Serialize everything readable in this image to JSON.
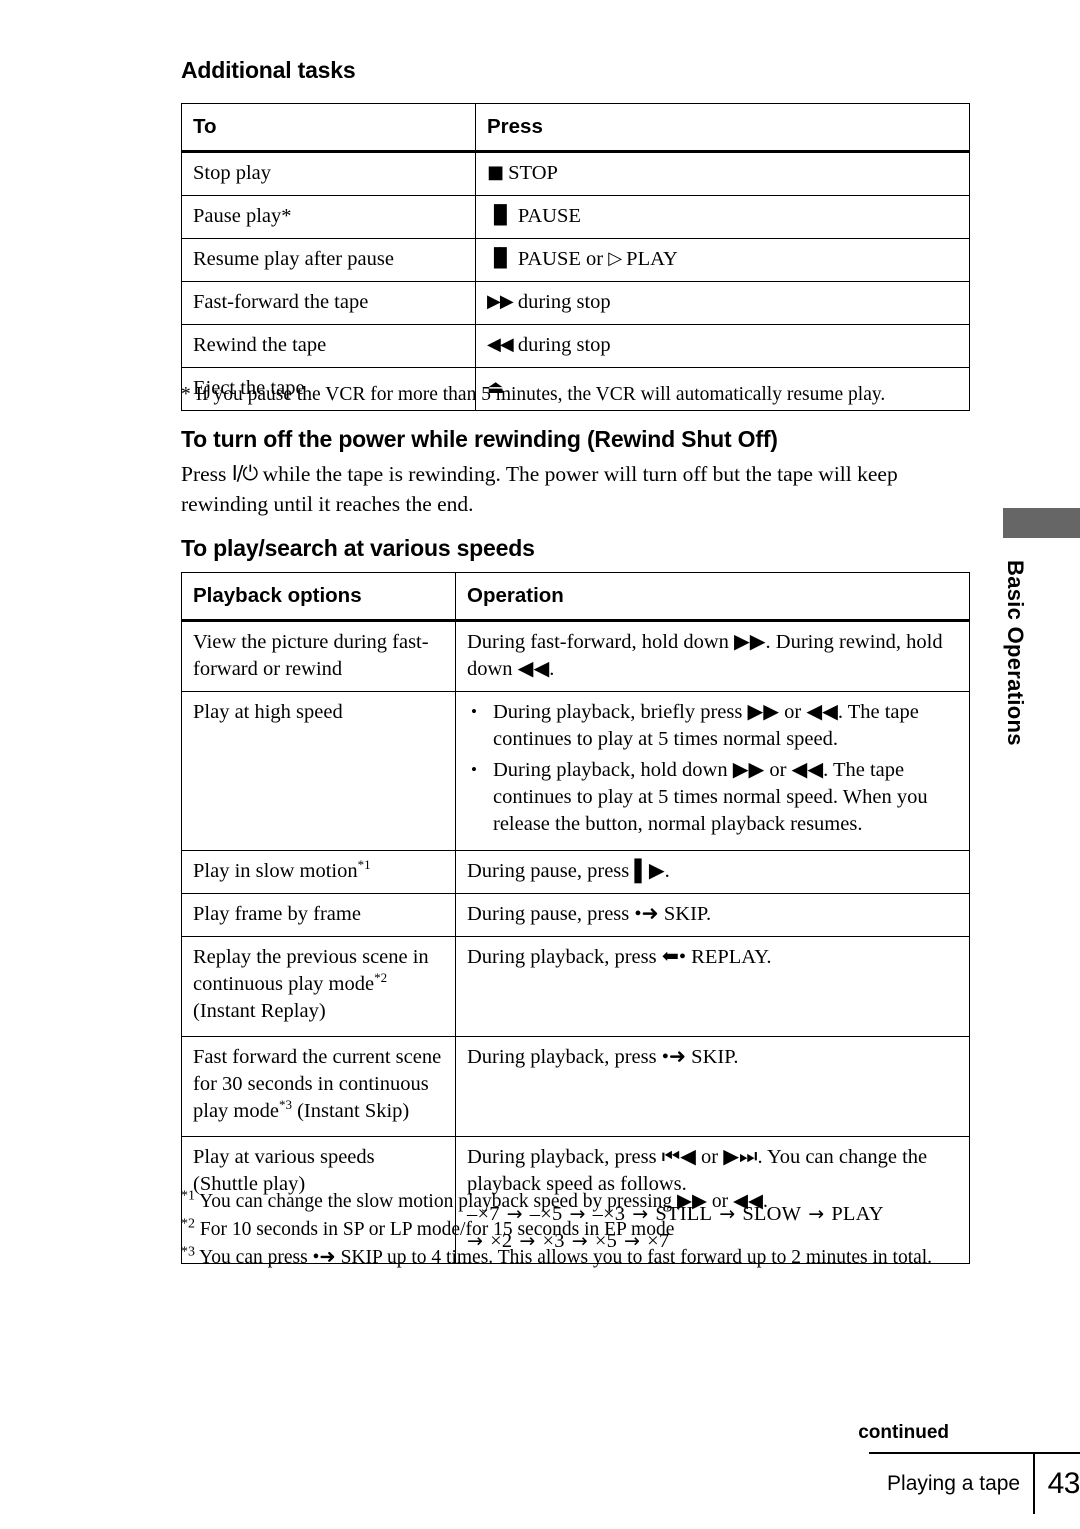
{
  "side_tab": {
    "label": "Basic Operations",
    "block_color": "#666666"
  },
  "sections": {
    "additional_tasks_heading": "Additional tasks",
    "rewind_shutoff_heading": "To turn off the power while rewinding (Rewind Shut Off)",
    "rewind_shutoff_para_1": "Press ",
    "rewind_shutoff_power_symbol": "I/⏻",
    "rewind_shutoff_para_2": " while the tape is rewinding.  The power will turn off but the tape will keep rewinding until it reaches the end.",
    "speeds_heading": "To play/search at various speeds",
    "pause_footnote": "* If you pause the VCR for more than 5 minutes, the VCR will automatically resume play."
  },
  "table_additional_tasks": {
    "headers": [
      "To",
      "Press"
    ],
    "rows": [
      {
        "to": "Stop play",
        "symbol": "■",
        "press": "STOP"
      },
      {
        "to": "Pause play*",
        "symbol": "▐▌",
        "press": "PAUSE"
      },
      {
        "to": "Resume play after pause",
        "symbol": "▐▌",
        "press": "PAUSE or",
        "symbol2": "▷",
        "press2": "PLAY"
      },
      {
        "to": "Fast-forward the tape",
        "symbol": "▶▶",
        "press": "during stop"
      },
      {
        "to": "Rewind the tape",
        "symbol": "◀◀",
        "press": "during stop"
      },
      {
        "to": "Eject the tape",
        "symbol": "⏏",
        "press": ""
      }
    ]
  },
  "table_playback_speeds": {
    "headers": [
      "Playback options",
      "Operation"
    ],
    "rows": [
      {
        "option": "View the picture during fast-forward or rewind",
        "operation_lines": [
          "During fast-forward, hold down ▶▶.  During rewind, hold down ◀◀."
        ]
      },
      {
        "option": "Play at high speed",
        "bullets": [
          "During playback, briefly press ▶▶ or ◀◀.  The tape continues to play at 5 times normal speed.",
          "During playback, hold down ▶▶ or ◀◀.  The tape continues to play at 5 times normal speed.  When you release the button, normal playback resumes."
        ]
      },
      {
        "option": "Play in slow motion",
        "option_footnote": "*1",
        "operation_lines": [
          "During pause, press ▌▶."
        ]
      },
      {
        "option": "Play frame by frame",
        "operation_lines": [
          "During pause, press •➜ SKIP."
        ]
      },
      {
        "option": "Replay the previous scene in continuous play mode",
        "option_footnote": "*2",
        "option_suffix": "(Instant Replay)",
        "operation_lines": [
          "During playback, press  ⬅• REPLAY."
        ]
      },
      {
        "option": "Fast forward the current scene for 30 seconds in continuous play mode",
        "option_footnote": "*3",
        "option_suffix": "(Instant Skip)",
        "operation_lines": [
          "During playback, press •➜ SKIP."
        ]
      },
      {
        "option": "Play at various speeds (Shuttle play)",
        "operation_lines": [
          "During playback, press ⏮◀ or ▶⏭.  You can change the playback speed as follows."
        ],
        "speed_sequence": [
          "–×7",
          "–×5",
          "–×3",
          "STILL",
          "SLOW",
          "PLAY",
          "×2",
          "×3",
          "×5",
          "×7"
        ]
      }
    ]
  },
  "footnotes": [
    {
      "marker": "*1",
      "text": "You can change the slow motion playback speed by pressing ▶▶ or ◀◀."
    },
    {
      "marker": "*2",
      "text": "For 10 seconds in SP or LP mode/for 15 seconds in EP mode"
    },
    {
      "marker": "*3",
      "text": "You can press •➜ SKIP up to 4 times.  This allows you to fast forward up to 2 minutes in total."
    }
  ],
  "footer": {
    "continued": "continued",
    "section_label": "Playing a tape",
    "page_number": "43"
  }
}
